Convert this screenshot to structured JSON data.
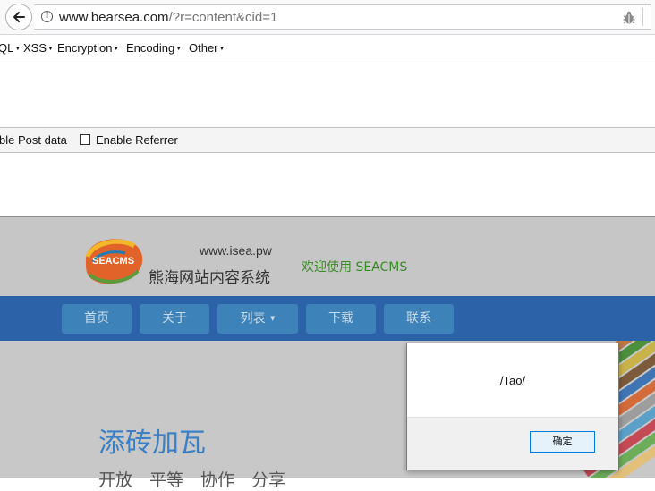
{
  "browser": {
    "url_host": "www.bearsea.com",
    "url_path": "/?r=content&cid=1"
  },
  "hackbar": {
    "menus": [
      "QL",
      "XSS",
      "Encryption",
      "Encoding",
      "Other"
    ],
    "options": {
      "post_label": "ble Post data",
      "referrer_label": "Enable Referrer",
      "referrer_checked": false
    }
  },
  "site": {
    "logo_text": "SEACMS",
    "domain": "www.isea.pw",
    "name": "熊海网站内容系统",
    "welcome": "欢迎使用 SEACMS",
    "nav": [
      "首页",
      "关于",
      "列表",
      "下载",
      "联系"
    ],
    "hero_title": "添砖加瓦",
    "hero_subtitle": "开放　平等　协作　分享",
    "colors": {
      "nav_bg": "#2c63a8",
      "nav_button": "#3d82b9",
      "title": "#3b7fc4",
      "welcome": "#3a8a27"
    }
  },
  "dialog": {
    "message": "/Tao/",
    "ok_label": "确定"
  }
}
